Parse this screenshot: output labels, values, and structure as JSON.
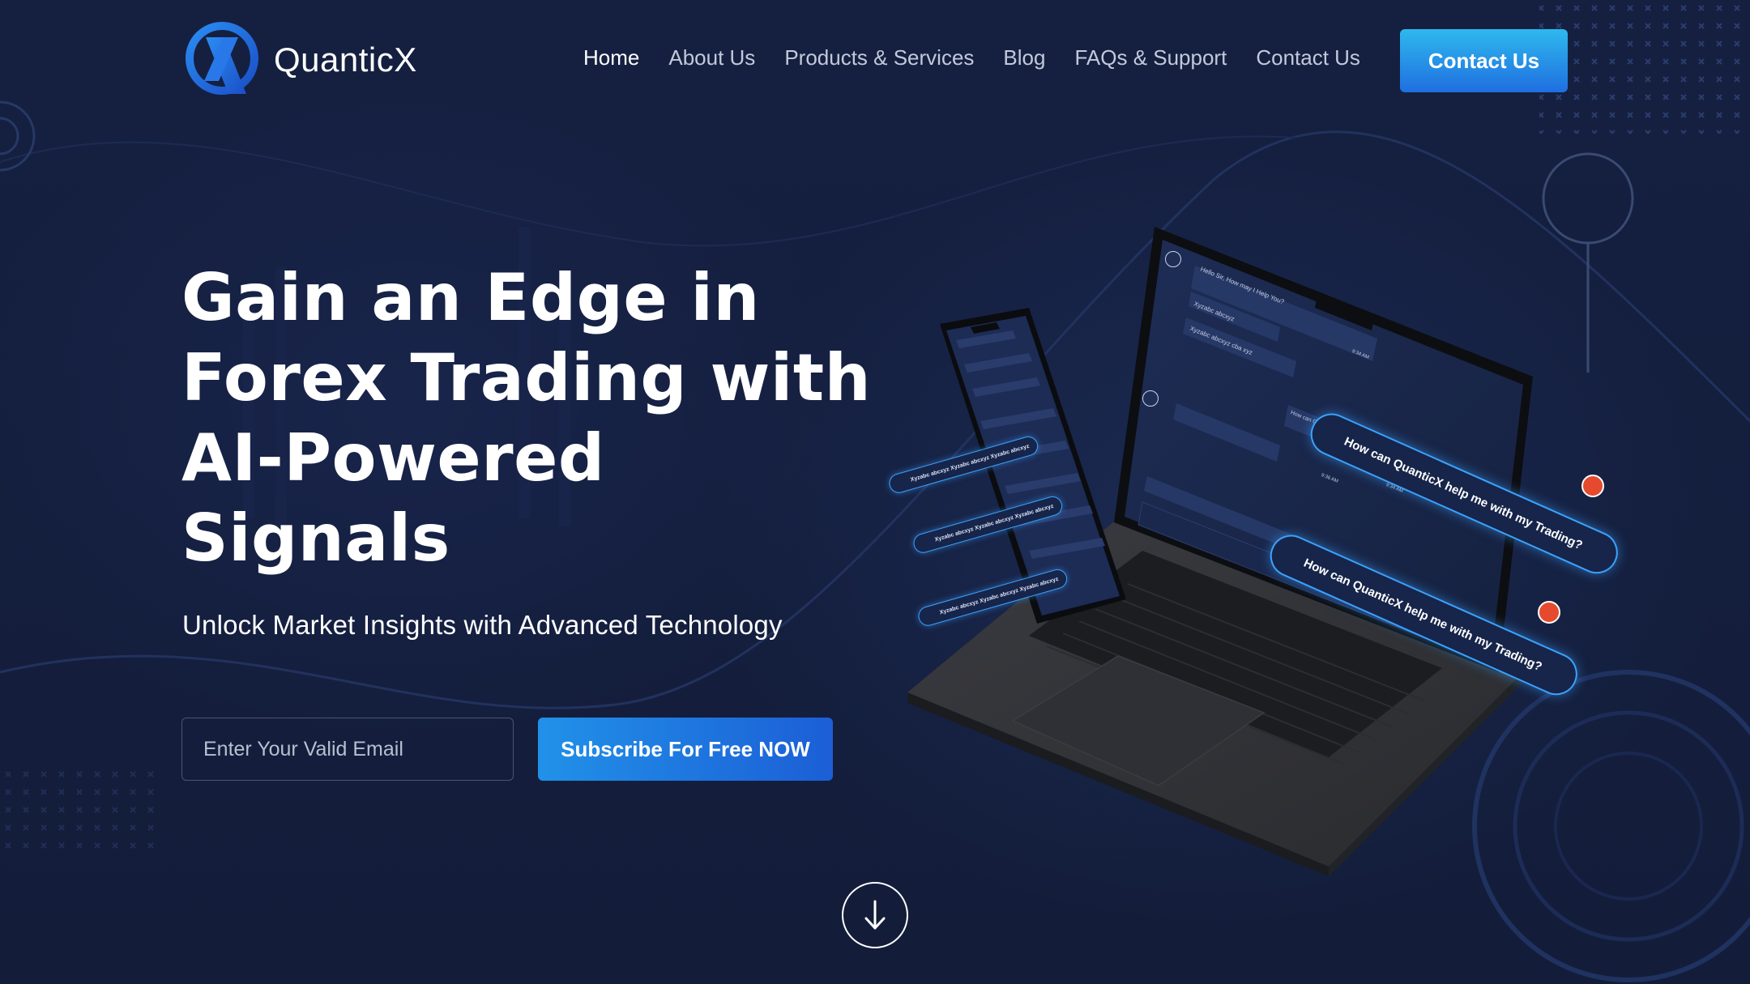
{
  "brand": {
    "name": "QuanticX",
    "logo_letter": "X",
    "accent": "#1f6fe0",
    "accent_light": "#2fb8ee",
    "background": "#141e3b"
  },
  "nav": {
    "items": [
      {
        "label": "Home",
        "active": true
      },
      {
        "label": "About Us",
        "active": false
      },
      {
        "label": "Products & Services",
        "active": false
      },
      {
        "label": "Blog",
        "active": false
      },
      {
        "label": "FAQs & Support",
        "active": false
      },
      {
        "label": "Contact Us",
        "active": false
      }
    ],
    "cta_label": "Contact Us"
  },
  "hero": {
    "title_lines": [
      "Gain an Edge in",
      "Forex Trading with",
      "AI-Powered",
      "Signals"
    ],
    "subtitle": "Unlock Market Insights with Advanced Technology",
    "email_placeholder": "Enter Your Valid Email",
    "subscribe_label": "Subscribe For Free NOW",
    "scroll_icon": "arrow-down-icon"
  },
  "illustration": {
    "laptop_chat": {
      "greeting": "Hello Sir, How may I Help You?",
      "reply_1": "Xyzabc abcxyz",
      "reply_2": "Xyzabc abcxyz cba xyz",
      "time_1": "9:34 AM",
      "question_small": "How can QuanticX help me with my Trading?",
      "time_2": "9:34 AM",
      "time_3": "9:36 AM"
    },
    "bubbles": {
      "big_1": "How can QuanticX help me with my Trading?",
      "big_2": "How can QuanticX help me with my Trading?",
      "phone_1": "Xyzabc abcxyz Xyzabc abcxyz Xyzabc abcxyz",
      "phone_2": "Xyzabc abcxyz Xyzabc abcxyz Xyzabc abcxyz",
      "phone_3": "Xyzabc abcxyz Xyzabc abcxyz Xyzabc abcxyz"
    }
  }
}
